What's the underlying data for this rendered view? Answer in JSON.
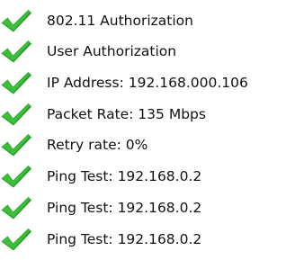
{
  "check_color": "#1f9a1f",
  "check_icon": "green-check-mark",
  "items": [
    {
      "label": "802.11 Authorization"
    },
    {
      "label": "User Authorization"
    },
    {
      "label": "IP Address: 192.168.000.106"
    },
    {
      "label": "Packet Rate: 135 Mbps"
    },
    {
      "label": "Retry rate: 0%"
    },
    {
      "label": "Ping Test: 192.168.0.2"
    },
    {
      "label": "Ping Test: 192.168.0.2"
    },
    {
      "label": "Ping Test: 192.168.0.2"
    }
  ]
}
